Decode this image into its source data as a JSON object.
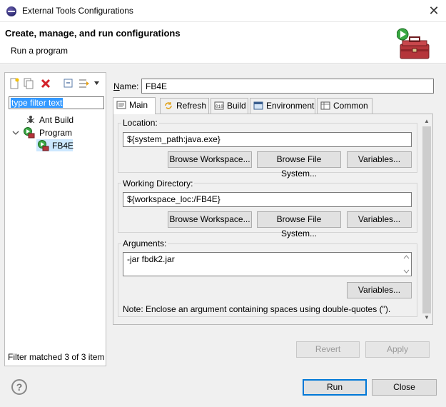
{
  "window": {
    "title": "External Tools Configurations",
    "close_glyph": "✕"
  },
  "header": {
    "title": "Create, manage, and run configurations",
    "subtitle": "Run a program"
  },
  "left": {
    "filter_placeholder": "type filter text",
    "tree": {
      "ant_build": "Ant Build",
      "program": "Program",
      "fb4e": "FB4E"
    },
    "filter_status": "Filter matched 3 of 3 item"
  },
  "config": {
    "name_label": "Name:",
    "name_value": "FB4E",
    "tabs": [
      "Main",
      "Refresh",
      "Build",
      "Environment",
      "Common"
    ],
    "location": {
      "label": "Location:",
      "value": "${system_path:java.exe}",
      "buttons": [
        "Browse Workspace...",
        "Browse File System...",
        "Variables..."
      ]
    },
    "working_dir": {
      "label": "Working Directory:",
      "value": "${workspace_loc:/FB4E}",
      "buttons": [
        "Browse Workspace...",
        "Browse File System...",
        "Variables..."
      ]
    },
    "arguments": {
      "label": "Arguments:",
      "value": "-jar fbdk2.jar",
      "variables_button": "Variables...",
      "note": "Note: Enclose an argument containing spaces using double-quotes (\")."
    },
    "revert_button": "Revert",
    "apply_button": "Apply"
  },
  "footer": {
    "help_glyph": "?",
    "run_button": "Run",
    "close_button": "Close"
  },
  "colors": {
    "selection": "#3399ff",
    "default_button_border": "#0078d7"
  }
}
